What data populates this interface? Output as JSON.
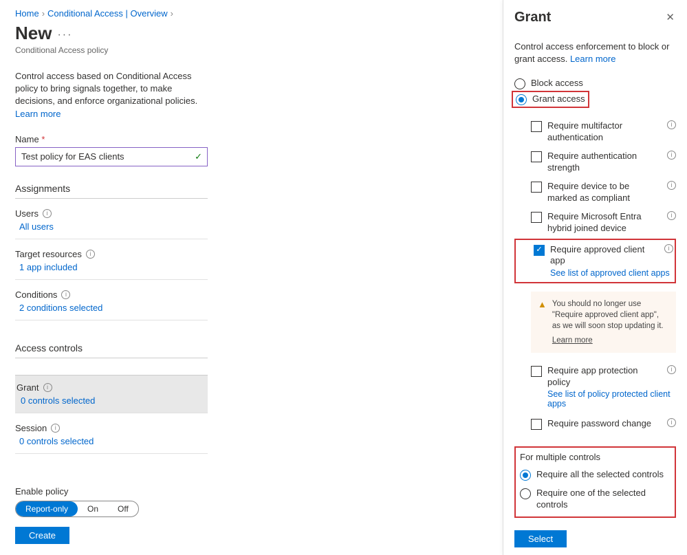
{
  "breadcrumb": {
    "home": "Home",
    "ca": "Conditional Access | Overview"
  },
  "page": {
    "title": "New",
    "subtitle": "Conditional Access policy",
    "description": "Control access based on Conditional Access policy to bring signals together, to make decisions, and enforce organizational policies.",
    "learn_more": "Learn more"
  },
  "name_field": {
    "label": "Name",
    "value": "Test policy for EAS clients"
  },
  "sections": {
    "assignments": "Assignments",
    "access_controls": "Access controls"
  },
  "rows": {
    "users_label": "Users",
    "users_value": "All users",
    "target_label": "Target resources",
    "target_value": "1 app included",
    "conditions_label": "Conditions",
    "conditions_value": "2 conditions selected",
    "grant_label": "Grant",
    "grant_value": "0 controls selected",
    "session_label": "Session",
    "session_value": "0 controls selected"
  },
  "footer": {
    "enable_label": "Enable policy",
    "opt1": "Report-only",
    "opt2": "On",
    "opt3": "Off",
    "create": "Create"
  },
  "panel": {
    "title": "Grant",
    "description": "Control access enforcement to block or grant access.",
    "learn_more": "Learn more",
    "block": "Block access",
    "grant": "Grant access",
    "req_mfa": "Require multifactor authentication",
    "req_auth_strength": "Require authentication strength",
    "req_compliant": "Require device to be marked as compliant",
    "req_hybrid": "Require Microsoft Entra hybrid joined device",
    "req_approved_app": "Require approved client app",
    "approved_link": "See list of approved client apps",
    "warning": "You should no longer use \"Require approved client app\", as we will soon stop updating it.",
    "warning_learn": "Learn more",
    "req_app_protection": "Require app protection policy",
    "protection_link": "See list of policy protected client apps",
    "req_pwd_change": "Require password change",
    "multi_header": "For multiple controls",
    "multi_all": "Require all the selected controls",
    "multi_one": "Require one of the selected controls",
    "select_btn": "Select"
  }
}
